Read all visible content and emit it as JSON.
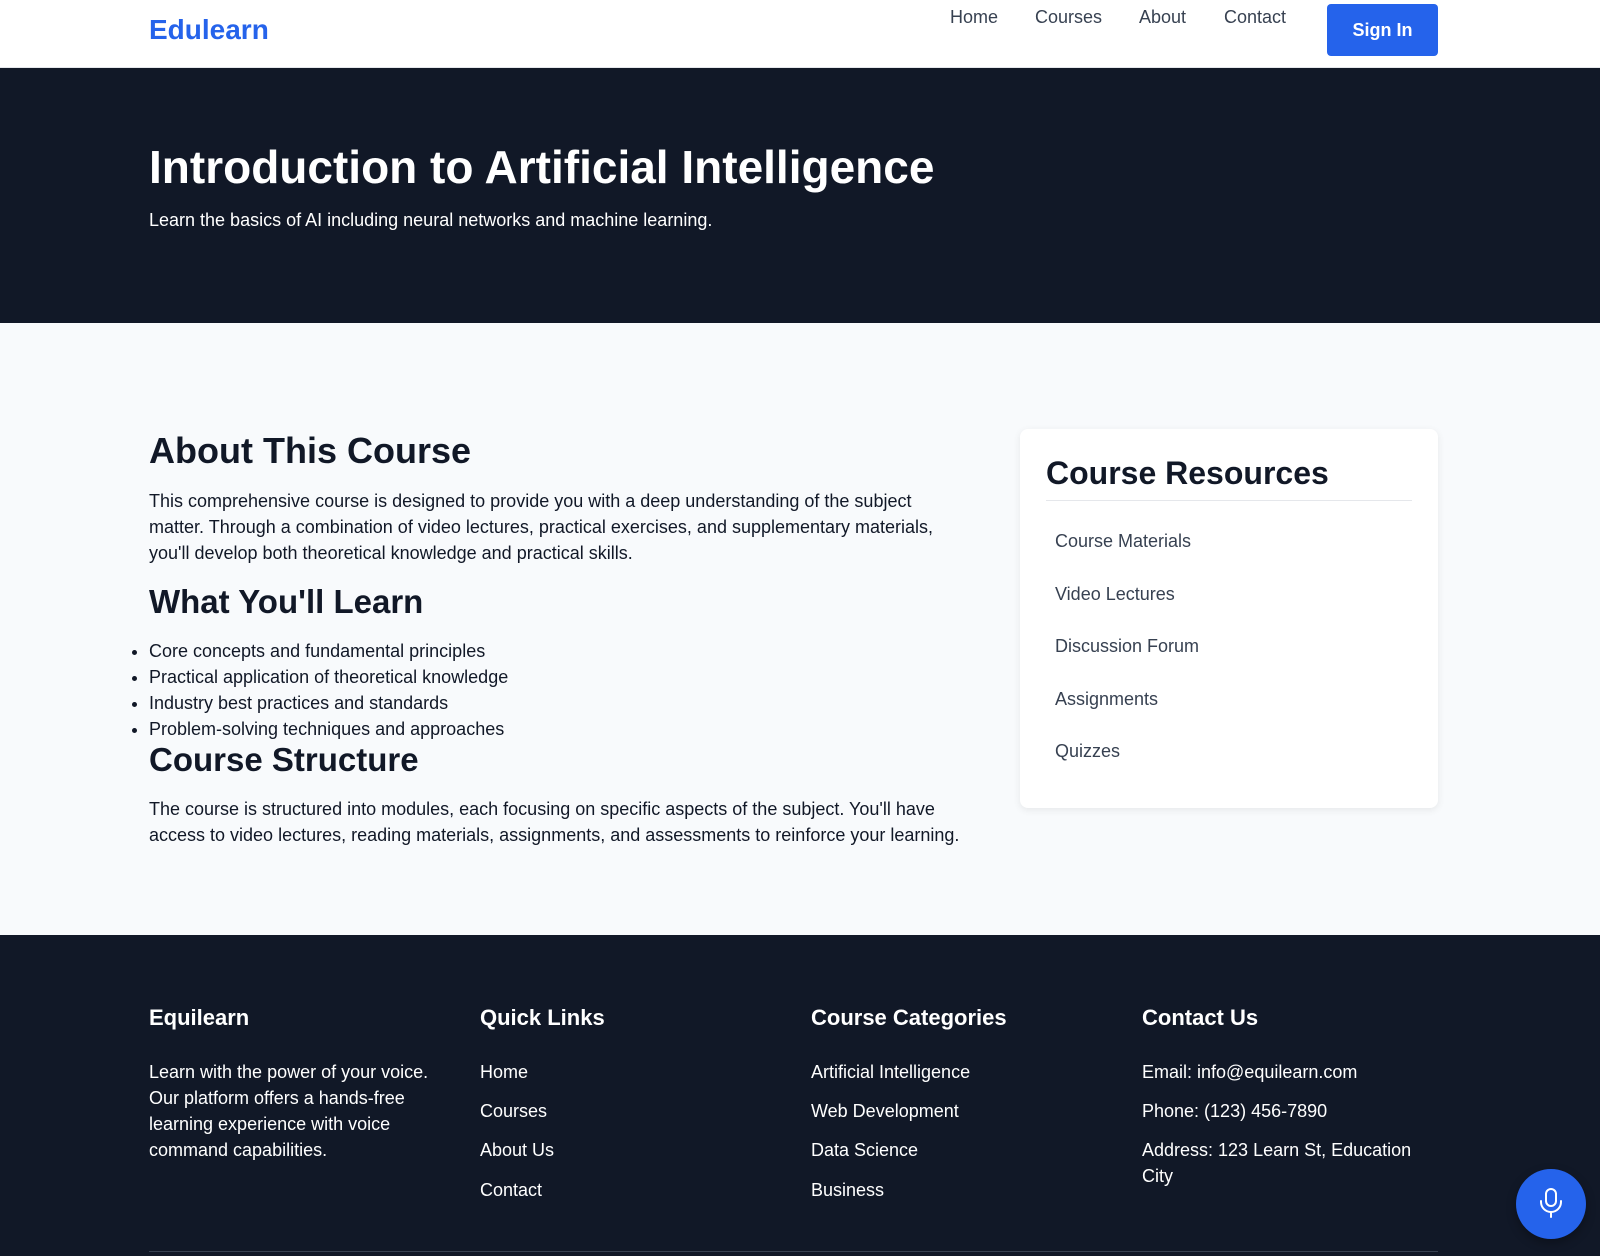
{
  "header": {
    "logo": "Edulearn",
    "nav": [
      "Home",
      "Courses",
      "About",
      "Contact"
    ],
    "signin_label": "Sign In"
  },
  "hero": {
    "title": "Introduction to Artificial Intelligence",
    "subtitle": "Learn the basics of AI including neural networks and machine learning."
  },
  "about": {
    "heading": "About This Course",
    "text": "This comprehensive course is designed to provide you with a deep understanding of the subject matter. Through a combination of video lectures, practical exercises, and supplementary materials, you'll develop both theoretical knowledge and practical skills."
  },
  "learn": {
    "heading": "What You'll Learn",
    "items": [
      "Core concepts and fundamental principles",
      "Practical application of theoretical knowledge",
      "Industry best practices and standards",
      "Problem-solving techniques and approaches"
    ]
  },
  "structure": {
    "heading": "Course Structure",
    "text": "The course is structured into modules, each focusing on specific aspects of the subject. You'll have access to video lectures, reading materials, assignments, and assessments to reinforce your learning."
  },
  "resources": {
    "title": "Course Resources",
    "items": [
      "Course Materials",
      "Video Lectures",
      "Discussion Forum",
      "Assignments",
      "Quizzes"
    ]
  },
  "footer": {
    "brand": {
      "title": "Equilearn",
      "text": "Learn with the power of your voice. Our platform offers a hands-free learning experience with voice command capabilities."
    },
    "quick_links": {
      "title": "Quick Links",
      "items": [
        "Home",
        "Courses",
        "About Us",
        "Contact"
      ]
    },
    "categories": {
      "title": "Course Categories",
      "items": [
        "Artificial Intelligence",
        "Web Development",
        "Data Science",
        "Business"
      ]
    },
    "contact": {
      "title": "Contact Us",
      "email": "Email: info@equilearn.com",
      "phone": "Phone: (123) 456-7890",
      "address": "Address: 123 Learn St, Education City"
    }
  },
  "mic_icon": "microphone-icon",
  "colors": {
    "accent": "#2563eb",
    "dark": "#111827",
    "background": "#f8fafc"
  }
}
